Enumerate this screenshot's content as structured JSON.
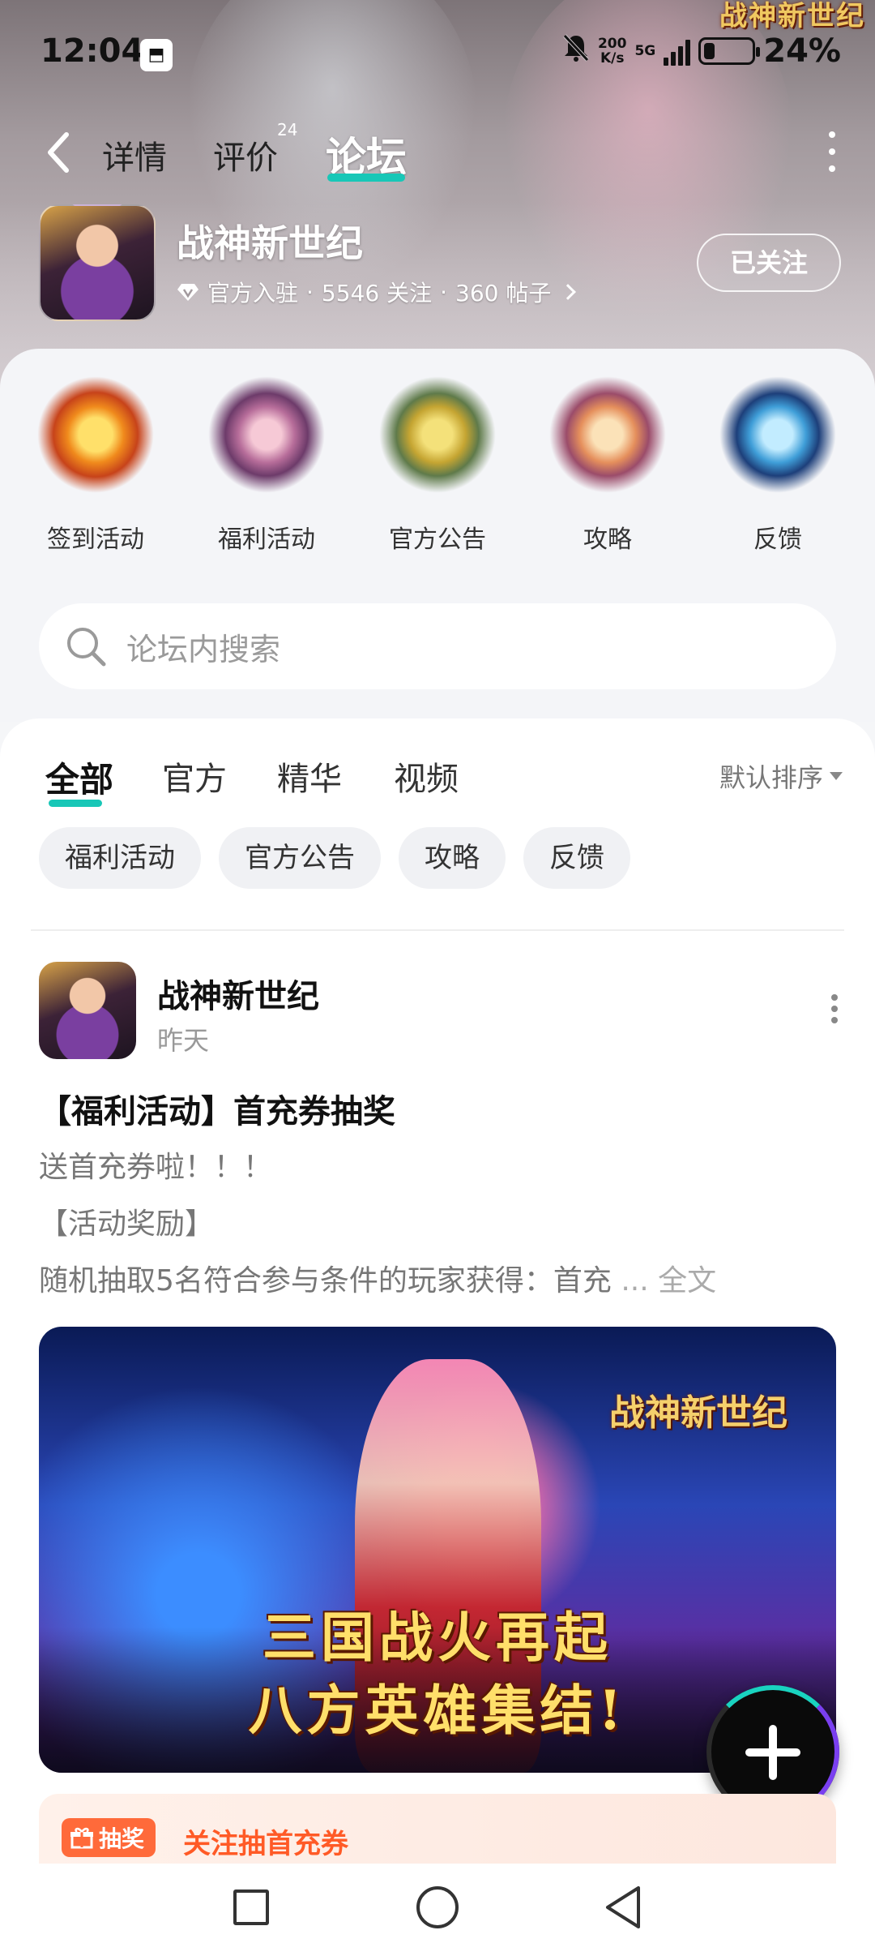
{
  "status_bar": {
    "time": "12:04",
    "app_badge": "◼",
    "net_speed_top": "200",
    "net_speed_bottom": "K/s",
    "network": "5G",
    "battery_percent": "24%",
    "battery_level": 0.24
  },
  "header": {
    "game_logo_text": "战神新世纪",
    "tabs": [
      {
        "label": "详情"
      },
      {
        "label": "评价",
        "badge": "24"
      },
      {
        "label": "论坛",
        "active": true
      }
    ],
    "accent_color": "#18c7b7"
  },
  "game": {
    "name": "战神新世纪",
    "meta_official": "官方入驻",
    "meta_followers": "5546 关注",
    "meta_posts": "360 帖子",
    "meta_sep": "·",
    "follow_label": "已关注"
  },
  "categories": [
    {
      "label": "签到活动"
    },
    {
      "label": "福利活动"
    },
    {
      "label": "官方公告"
    },
    {
      "label": "攻略"
    },
    {
      "label": "反馈"
    }
  ],
  "search": {
    "placeholder": "论坛内搜索"
  },
  "filter_tabs": [
    {
      "label": "全部",
      "active": true
    },
    {
      "label": "官方"
    },
    {
      "label": "精华"
    },
    {
      "label": "视频"
    }
  ],
  "sort_label": "默认排序",
  "chips": [
    "福利活动",
    "官方公告",
    "攻略",
    "反馈"
  ],
  "post": {
    "author": "战神新世纪",
    "time": "昨天",
    "title": "【福利活动】首充券抽奖",
    "line1": "送首充券啦！！！",
    "line2": "【活动奖励】",
    "line3": "随机抽取5名符合参与条件的玩家获得：首充",
    "ellipsis": " ... ",
    "full_text_link": "全文",
    "image_logo": "战神新世纪",
    "image_slogan_1": "三国战火再起",
    "image_slogan_2": "八方英雄集结!"
  },
  "promo": {
    "badge": "抽奖",
    "text": "关注抽首充券"
  }
}
